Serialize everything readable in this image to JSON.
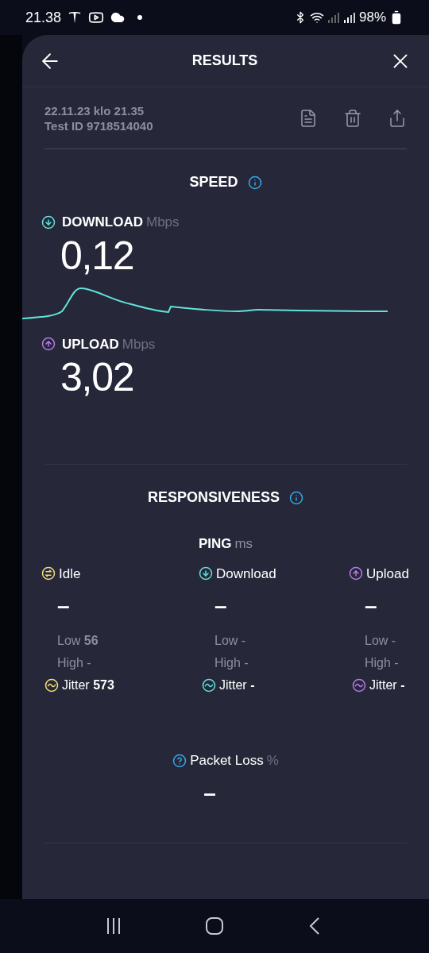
{
  "status_bar": {
    "time": "21.38",
    "battery": "98%"
  },
  "header": {
    "title": "RESULTS"
  },
  "test": {
    "date": "22.11.23 klo 21.35",
    "test_id": "Test ID 9718514040"
  },
  "speed": {
    "title": "SPEED",
    "metrics": [
      {
        "kind": "download",
        "label": "DOWNLOAD",
        "unit": "Mbps",
        "value": "0,12"
      },
      {
        "kind": "upload",
        "label": "UPLOAD",
        "unit": "Mbps",
        "value": "3,02"
      }
    ]
  },
  "responsiveness": {
    "title": "RESPONSIVENESS",
    "ping": {
      "label": "PING",
      "unit": "ms"
    },
    "columns": [
      {
        "kind": "idle",
        "label": "Idle",
        "value": "–",
        "low": "Low **56**",
        "high": "High -",
        "jitter": "Jitter **573**"
      },
      {
        "kind": "download",
        "label": "Download",
        "value": "–",
        "low": "Low -",
        "high": "High -",
        "jitter": "Jitter **-**"
      },
      {
        "kind": "upload",
        "label": "Upload",
        "value": "–",
        "low": "Low -",
        "high": "High -",
        "jitter": "Jitter **-**"
      }
    ]
  },
  "packet_loss": {
    "label": "Packet Loss",
    "unit": "%",
    "value": "–"
  }
}
